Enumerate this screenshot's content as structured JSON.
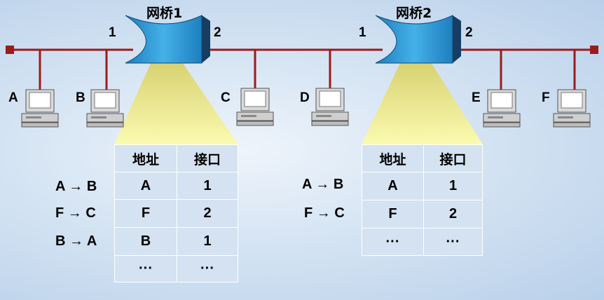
{
  "bridges": [
    {
      "title": "网桥1",
      "port_left": "1",
      "port_right": "2"
    },
    {
      "title": "网桥2",
      "port_left": "1",
      "port_right": "2"
    }
  ],
  "hosts": [
    "A",
    "B",
    "C",
    "D",
    "E",
    "F"
  ],
  "tables": [
    {
      "headers": [
        "地址",
        "接口"
      ],
      "rows": [
        [
          "A",
          "1"
        ],
        [
          "F",
          "2"
        ],
        [
          "B",
          "1"
        ],
        [
          "···",
          "···"
        ]
      ],
      "frames": [
        "A → B",
        "F → C",
        "B → A"
      ]
    },
    {
      "headers": [
        "地址",
        "接口"
      ],
      "rows": [
        [
          "A",
          "1"
        ],
        [
          "F",
          "2"
        ],
        [
          "···",
          "···"
        ]
      ],
      "frames": [
        "A → B",
        "F → C"
      ]
    }
  ],
  "colors": {
    "lan": "#9b1b1b",
    "bridge": "#2c8fcf",
    "beam": "#f7f59b",
    "table": "#d4e2f1"
  }
}
